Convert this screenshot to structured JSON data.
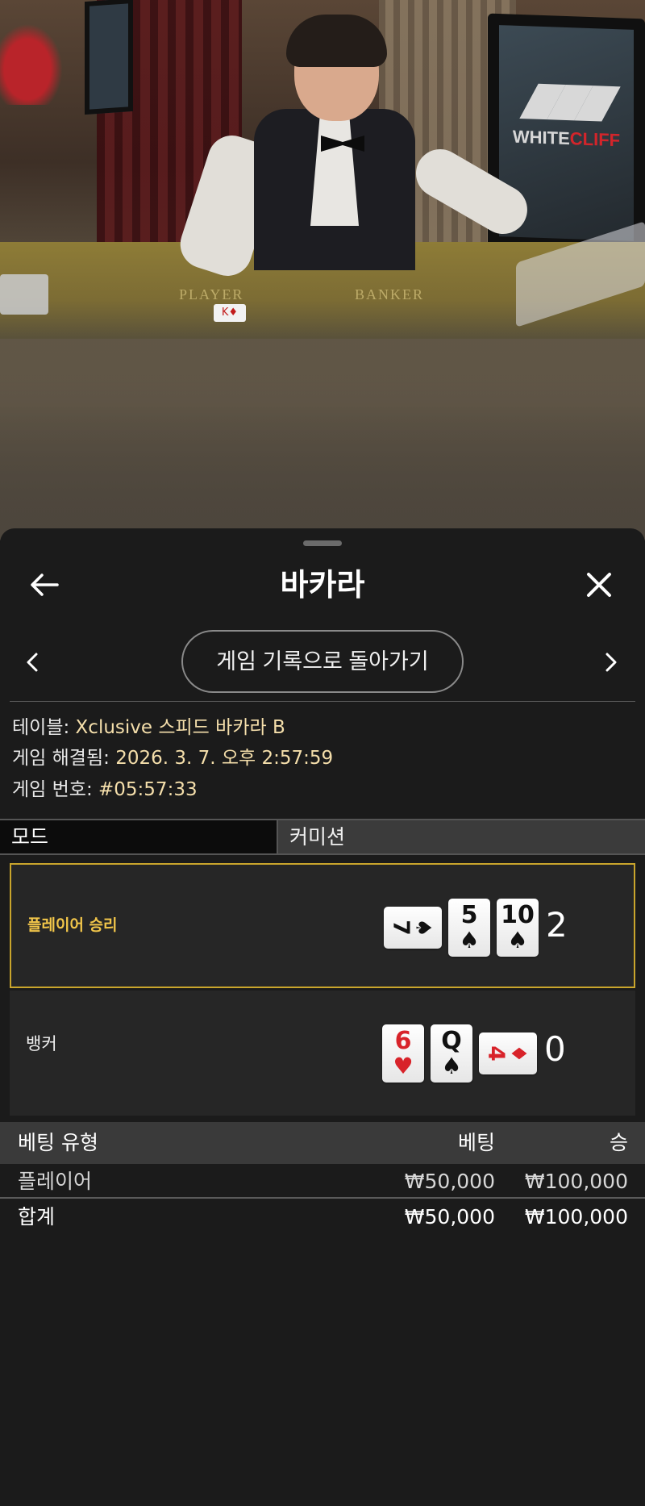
{
  "video": {
    "brand": {
      "white": "WHITE",
      "accent": "CLIFF"
    },
    "table_labels": {
      "player": "PLAYER",
      "banker": "BANKER"
    }
  },
  "header": {
    "title": "바카라"
  },
  "nav": {
    "history_button": "게임 기록으로 돌아가기"
  },
  "info": {
    "table_label": "테이블:",
    "table_value": "Xclusive 스피드 바카라 B",
    "resolved_label": "게임 해결됨:",
    "resolved_value": "2026. 3. 7. 오후 2:57:59",
    "game_no_label": "게임 번호:",
    "game_no_value": "#05:57:33"
  },
  "mode_bar": {
    "mode": "모드",
    "commission": "커미션"
  },
  "results": {
    "player": {
      "label": "플레이어 승리",
      "score": "2",
      "cards": [
        {
          "rank": "7",
          "suit": "♠",
          "color": "black",
          "sideways": true
        },
        {
          "rank": "5",
          "suit": "♠",
          "color": "black",
          "sideways": false
        },
        {
          "rank": "10",
          "suit": "♠",
          "color": "black",
          "sideways": false
        }
      ]
    },
    "banker": {
      "label": "뱅커",
      "score": "0",
      "cards": [
        {
          "rank": "6",
          "suit": "♥",
          "color": "red",
          "sideways": false
        },
        {
          "rank": "Q",
          "suit": "♠",
          "color": "black",
          "sideways": false
        },
        {
          "rank": "4",
          "suit": "♦",
          "color": "red",
          "sideways": true
        }
      ]
    }
  },
  "bets": {
    "headers": {
      "type": "베팅 유형",
      "bet": "베팅",
      "win": "승"
    },
    "rows": [
      {
        "type": "플레이어",
        "bet": "₩50,000",
        "win": "₩100,000"
      }
    ],
    "total": {
      "type": "합계",
      "bet": "₩50,000",
      "win": "₩100,000"
    }
  },
  "colors": {
    "accent_gold": "#c9a52c",
    "value_text": "#f5dfab",
    "winner_label": "#f2c64a",
    "sheet_bg": "#1b1b1b"
  },
  "icons": {
    "back": "arrow-left-icon",
    "close": "close-icon",
    "prev": "chevron-left-icon",
    "next": "chevron-right-icon"
  }
}
